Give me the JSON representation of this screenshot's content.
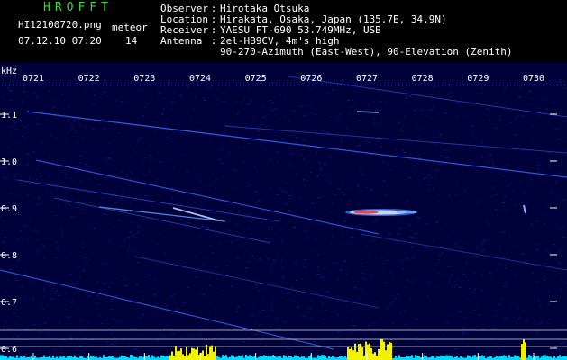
{
  "header": {
    "app_title": "HROFFT",
    "file_name": "HI12100720.png",
    "meteor_label": "meteor",
    "date_time": "07.12.10 07:20",
    "meteor_count": "14"
  },
  "info": [
    {
      "key": "Observer",
      "sep": ":",
      "value": "Hirotaka Otsuka"
    },
    {
      "key": "Location",
      "sep": ":",
      "value": "Hirakata, Osaka, Japan (135.7E, 34.9N)"
    },
    {
      "key": "Receiver",
      "sep": ":",
      "value": "YAESU FT-690 53.749MHz, USB"
    },
    {
      "key": "Antenna",
      "sep": ":",
      "value": "2el-HB9CV, 4m's high"
    },
    {
      "key": "",
      "sep": "",
      "value": "90-270-Azimuth (East-West), 90-Elevation (Zenith)"
    }
  ],
  "axes": {
    "y_unit": "kHz",
    "y_ticks": [
      "1.1",
      "1.0",
      "0.9",
      "0.8",
      "0.7",
      "0.6"
    ],
    "y_values": [
      1.1,
      1.0,
      0.9,
      0.8,
      0.7,
      0.6
    ],
    "y_range": [
      0.575,
      1.175
    ],
    "x_ticks": [
      "0721",
      "0722",
      "0723",
      "0724",
      "0725",
      "0726",
      "0727",
      "0728",
      "0729",
      "0730"
    ],
    "x_values": [
      1,
      2,
      3,
      4,
      5,
      6,
      7,
      8,
      9,
      10
    ],
    "x_range": [
      0.4,
      10.6
    ]
  },
  "colors": {
    "background": "#00003a",
    "noise": "#1a2cb0",
    "trace": "#4a78ff",
    "meteor_core": "#ff3030",
    "activity_yellow": "#f2f200",
    "activity_cyan": "#00d8ff",
    "grid": "#ffffff",
    "title": "#38d838"
  }
}
